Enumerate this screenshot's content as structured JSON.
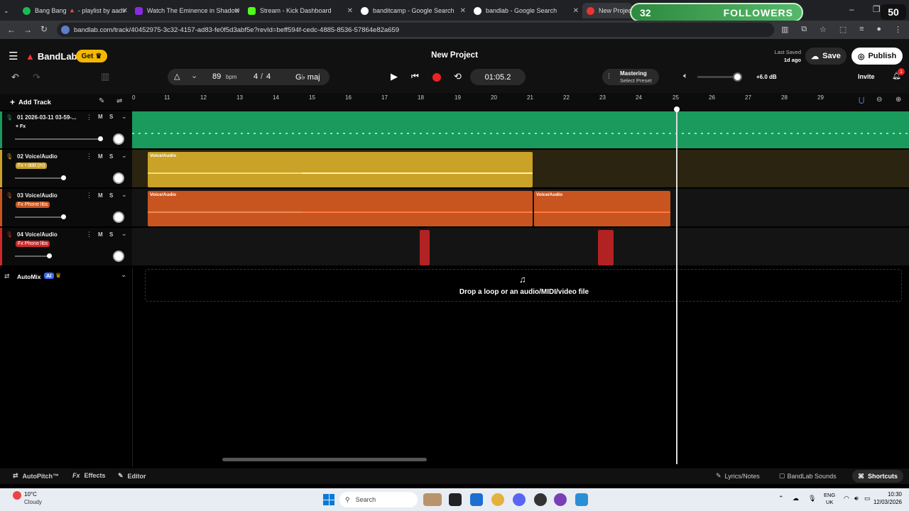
{
  "browser": {
    "tabs": [
      {
        "title": "Bang Bang 🔺 - playlist by aadv",
        "color": "#1db954"
      },
      {
        "title": "Watch The Eminence in Shadow",
        "color": "#8a2be2"
      },
      {
        "title": "Stream - Kick Dashboard",
        "color": "#53fc18"
      },
      {
        "title": "banditcamp - Google Search",
        "color": "#4285f4"
      },
      {
        "title": "bandlab - Google Search",
        "color": "#4285f4"
      },
      {
        "title": "New Project",
        "color": "#e33"
      }
    ],
    "url": "bandlab.com/track/40452975-3c32-4157-ad83-fe0f5d3abf5e?revId=beff594f-cedc-4885-8536-57864e82a659"
  },
  "overlay": {
    "count": "32",
    "label": "FOLLOWERS",
    "right_count": "50"
  },
  "app": {
    "brand": "BandLab",
    "get_label": "Get",
    "project_title": "New Project",
    "last_saved_label": "Last Saved",
    "last_saved_time": "1d ago",
    "save_label": "Save",
    "publish_label": "Publish",
    "invite_label": "Invite",
    "notification_count": "1",
    "bpm": "89",
    "bpm_unit": "bpm",
    "time_sig_num": "4",
    "time_sig_den": "4",
    "key": "G♭ maj",
    "time": "01:05.2",
    "mastering_label": "Mastering",
    "mastering_preset": "Select Preset",
    "volume_db": "+6.0 dB",
    "add_track_label": "Add Track"
  },
  "ruler": [
    "0",
    "11",
    "12",
    "13",
    "14",
    "15",
    "16",
    "17",
    "18",
    "19",
    "20",
    "21",
    "22",
    "23",
    "24",
    "25",
    "26",
    "27",
    "28",
    "29"
  ],
  "tracks": [
    {
      "name": "01  2026-03-11 03-59-...",
      "fx": "+ Fx",
      "color": "#1a9a5c"
    },
    {
      "name": "02  Voice/Audio",
      "fx": "Fx  • ddd (m)",
      "color": "#c9a227",
      "clip_label": "Voice/Audio"
    },
    {
      "name": "03  Voice/Audio",
      "fx": "Fx  Phone libs",
      "color": "#c8551f",
      "clip_label": "Voice/Audio",
      "clip2_label": "Voice/Audio"
    },
    {
      "name": "04  Voice/Audio",
      "fx": "Fx  Phone libs",
      "color": "#d02828"
    }
  ],
  "automix": {
    "label": "AutoMix",
    "ai_badge": "AI"
  },
  "drop_hint": "Drop a loop or an audio/MIDI/video file",
  "bottom": {
    "autopitch": "AutoPitch™",
    "effects": "Effects",
    "editor": "Editor",
    "lyrics": "Lyrics/Notes",
    "sounds": "BandLab Sounds",
    "shortcuts": "Shortcuts"
  },
  "taskbar": {
    "weather_temp": "10°C",
    "weather_desc": "Cloudy",
    "search": "Search",
    "lang1": "ENG",
    "lang2": "UK",
    "time": "10:30",
    "date": "12/03/2026"
  }
}
